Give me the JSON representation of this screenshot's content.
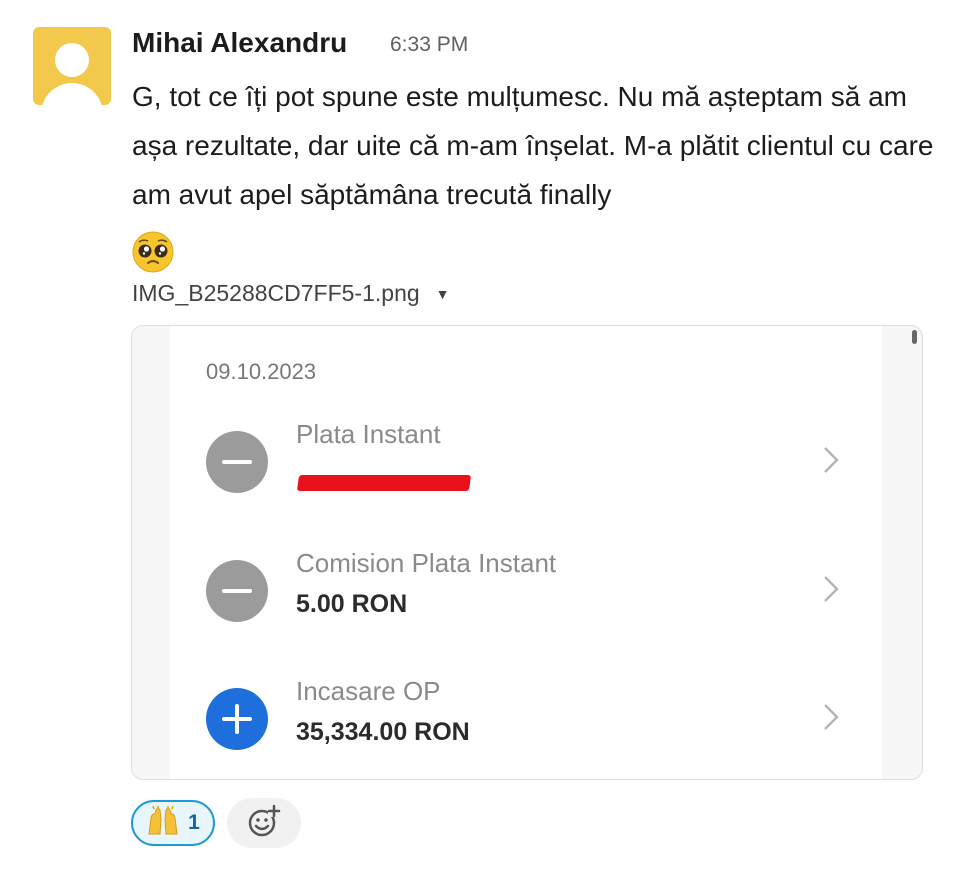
{
  "message": {
    "author": "Mihai Alexandru",
    "time": "6:33 PM",
    "text": "G, tot ce îți pot spune este mulțumesc. Nu mă așteptam să am așa rezultate, dar uite că m-am înșelat. M-a plătit clientul cu care am avut apel săptămâna trecută finally",
    "emoji": "pleading-face-emoji"
  },
  "attachment": {
    "filename": "IMG_B25288CD7FF5-1.png",
    "date": "09.10.2023",
    "transactions": [
      {
        "title": "Plata Instant",
        "amount": "",
        "type": "debit",
        "redacted": true
      },
      {
        "title": "Comision Plata Instant",
        "amount": "5.00 RON",
        "type": "debit",
        "redacted": false
      },
      {
        "title": "Incasare OP",
        "amount": "35,334.00 RON",
        "type": "credit",
        "redacted": false
      }
    ]
  },
  "reactions": [
    {
      "emoji": "raising-hands-emoji",
      "count": "1"
    }
  ],
  "colors": {
    "avatar": "#f2c94c",
    "credit_icon": "#1e6fdb",
    "debit_icon": "#9b9b9b",
    "redaction": "#e8101a",
    "reaction_border": "#1d9bd1"
  }
}
